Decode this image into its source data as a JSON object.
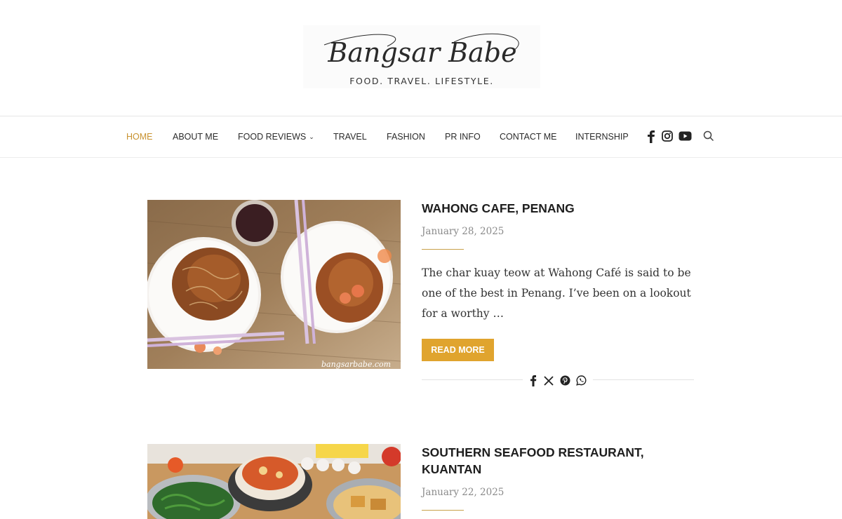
{
  "site": {
    "logo_script": "Bangsar Babe",
    "tagline": "FOOD.  TRAVEL.  LIFESTYLE."
  },
  "nav": {
    "items": [
      {
        "label": "HOME",
        "active": true
      },
      {
        "label": "ABOUT ME"
      },
      {
        "label": "FOOD REVIEWS",
        "has_dropdown": true
      },
      {
        "label": "TRAVEL"
      },
      {
        "label": "FASHION"
      },
      {
        "label": "PR INFO"
      },
      {
        "label": "CONTACT ME"
      },
      {
        "label": "INTERNSHIP"
      }
    ],
    "social_icons": [
      "facebook-icon",
      "instagram-icon",
      "youtube-icon"
    ],
    "search_icon": "search-icon"
  },
  "posts": [
    {
      "title": "WAHONG CAFE, PENANG",
      "date": "January 28, 2025",
      "excerpt": "The char kuay teow at Wahong Café is said to be one of the best in Penang. I’ve been on a lookout for a worthy …",
      "read_more": "READ MORE",
      "image_watermark": "bangsarbabe.com",
      "share_icons": [
        "facebook-icon",
        "x-icon",
        "pinterest-icon",
        "whatsapp-icon"
      ]
    },
    {
      "title": "SOUTHERN SEAFOOD RESTAURANT, KUANTAN",
      "date": "January 22, 2025"
    }
  ],
  "colors": {
    "accent": "#e0a42e",
    "nav_active": "#c8922f",
    "divider": "#c8a14a"
  }
}
